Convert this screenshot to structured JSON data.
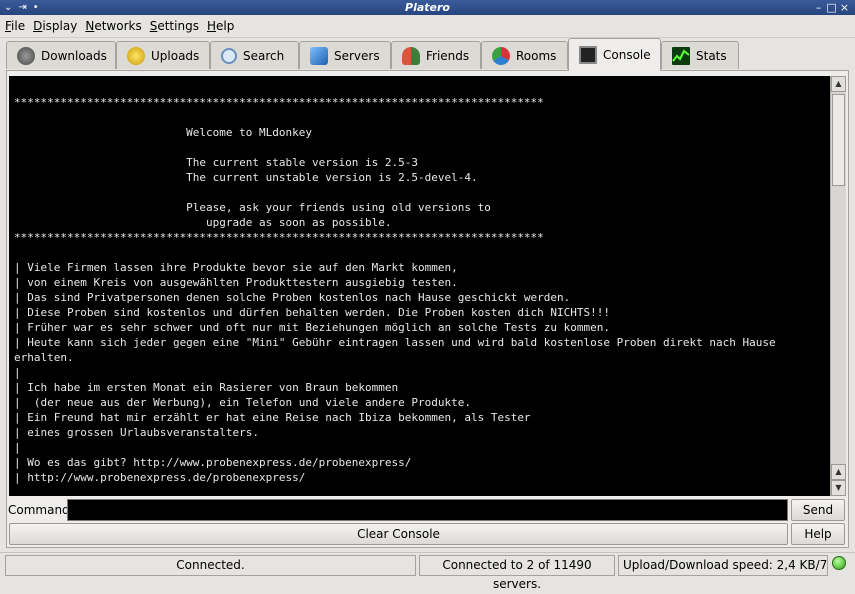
{
  "window": {
    "title": "Platero"
  },
  "menu": [
    "File",
    "Display",
    "Networks",
    "Settings",
    "Help"
  ],
  "tabs": [
    {
      "label": "Downloads",
      "icon": "downloads-icon",
      "color": "#6b6b6b"
    },
    {
      "label": "Uploads",
      "icon": "uploads-icon",
      "color": "#e0b800"
    },
    {
      "label": "Search",
      "icon": "search-icon",
      "color": "#8fb3d9"
    },
    {
      "label": "Servers",
      "icon": "servers-icon",
      "color": "#3a7fd0"
    },
    {
      "label": "Friends",
      "icon": "friends-icon",
      "color": "#c84a3a"
    },
    {
      "label": "Rooms",
      "icon": "rooms-icon",
      "color": "#2f8a3a"
    },
    {
      "label": "Console",
      "icon": "console-icon",
      "color": "#222222"
    },
    {
      "label": "Stats",
      "icon": "stats-icon",
      "color": "#1a8a1a"
    }
  ],
  "active_tab": "Console",
  "console": {
    "text": "\n********************************************************************************\n\n                          Welcome to MLdonkey\n\n                          The current stable version is 2.5-3\n                          The current unstable version is 2.5-devel-4.\n\n                          Please, ask your friends using old versions to\n                             upgrade as soon as possible.\n********************************************************************************\n\n| Viele Firmen lassen ihre Produkte bevor sie auf den Markt kommen,\n| von einem Kreis von ausgewählten Produkttestern ausgiebig testen.\n| Das sind Privatpersonen denen solche Proben kostenlos nach Hause geschickt werden.\n| Diese Proben sind kostenlos und dürfen behalten werden. Die Proben kosten dich NICHTS!!!\n| Früher war es sehr schwer und oft nur mit Beziehungen möglich an solche Tests zu kommen.\n| Heute kann sich jeder gegen eine \"Mini\" Gebühr eintragen lassen und wird bald kostenlose Proben direkt nach Hause\nerhalten.\n|\n| Ich habe im ersten Monat ein Rasierer von Braun bekommen\n|  (der neue aus der Werbung), ein Telefon und viele andere Produkte.\n| Ein Freund hat mir erzählt er hat eine Reise nach Ibiza bekommen, als Tester\n| eines grossen Urlaubsveranstalters.\n|\n| Wo es das gibt? http://www.probenexpress.de/probenexpress/\n| http://www.probenexpress.de/probenexpress/"
  },
  "command": {
    "label": "Command:",
    "value": "",
    "send_label": "Send",
    "help_label": "Help",
    "clear_label": "Clear Console"
  },
  "status": {
    "connection": "Connected.",
    "servers": "Connected to 2 of 11490 servers.",
    "speed": "Upload/Download speed: 2,4 KB/7 B",
    "led_color": "#33b51a"
  }
}
